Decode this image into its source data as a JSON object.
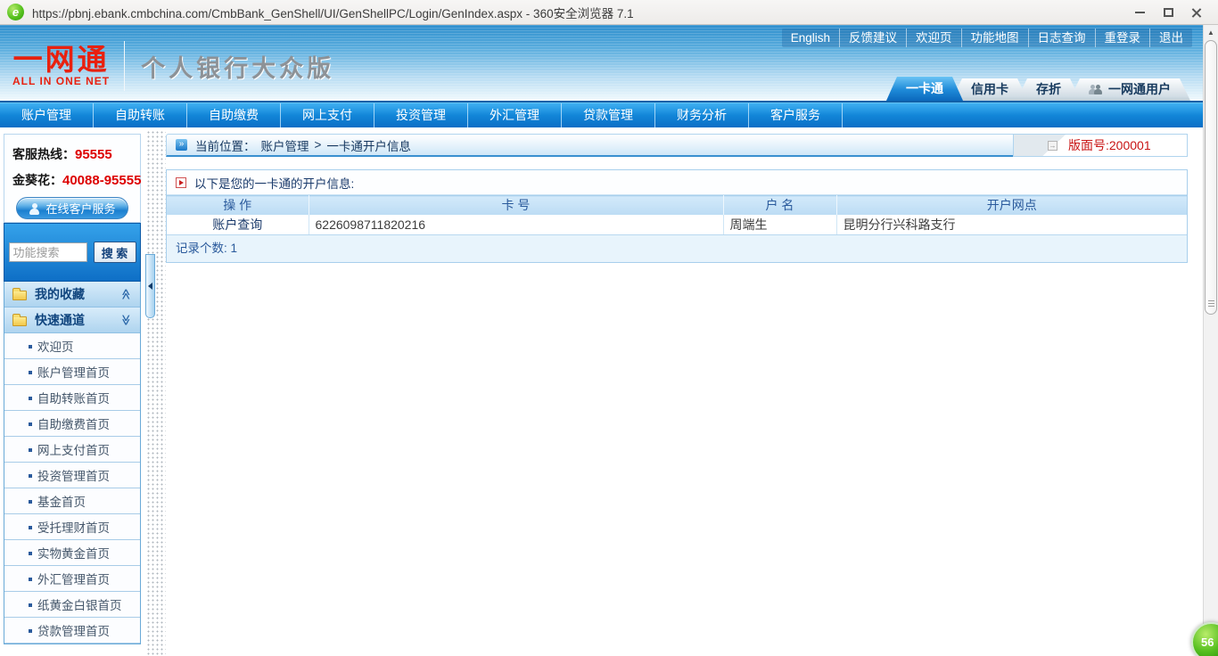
{
  "browser": {
    "title": "https://pbnj.ebank.cmbchina.com/CmbBank_GenShell/UI/GenShellPC/Login/GenIndex.aspx - 360安全浏览器 7.1",
    "speed_ball": "56"
  },
  "icons": {
    "collapse_up": "≪",
    "expand_down": "≫",
    "breadcrumb_arrow": "»",
    "scroll_up": "▲",
    "page_arrow": "→"
  },
  "header": {
    "top_links": [
      "English",
      "反馈建议",
      "欢迎页",
      "功能地图",
      "日志查询",
      "重登录",
      "退出"
    ],
    "logo": {
      "brand": "一网通",
      "brand_sub": "ALL IN ONE NET",
      "product": "个人银行大众版"
    },
    "tabs": [
      {
        "label": "一卡通",
        "active": true
      },
      {
        "label": "信用卡",
        "active": false
      },
      {
        "label": "存折",
        "active": false
      },
      {
        "label": "一网通用户",
        "active": false
      }
    ]
  },
  "nav": {
    "items": [
      "账户管理",
      "自助转账",
      "自助缴费",
      "网上支付",
      "投资管理",
      "外汇管理",
      "贷款管理",
      "财务分析",
      "客户服务"
    ]
  },
  "sidebar": {
    "hotline": {
      "label": "客服热线：",
      "number": "95555"
    },
    "vip": {
      "label": "金葵花：",
      "number": "40088-95555"
    },
    "service_button": "在线客户服务",
    "search": {
      "placeholder": "功能搜索",
      "button": "搜 索"
    },
    "sections": [
      {
        "label": "我的收藏"
      },
      {
        "label": "快速通道"
      }
    ],
    "quick_links": [
      "欢迎页",
      "账户管理首页",
      "自助转账首页",
      "自助缴费首页",
      "网上支付首页",
      "投资管理首页",
      "基金首页",
      "受托理财首页",
      "实物黄金首页",
      "外汇管理首页",
      "纸黄金白银首页",
      "贷款管理首页"
    ]
  },
  "main": {
    "breadcrumb": {
      "label": "当前位置：",
      "path": "账户管理",
      "sep": ">",
      "current": "一卡通开户信息",
      "page_no": "版面号:200001"
    },
    "panel": {
      "title": "以下是您的一卡通的开户信息:",
      "table": {
        "headers": [
          "操 作",
          "卡 号",
          "户 名",
          "开户网点"
        ],
        "rows": [
          [
            "账户查询",
            "6226098711820216",
            "周端生",
            "昆明分行兴科路支行"
          ]
        ]
      },
      "record_count": "记录个数: 1"
    }
  },
  "colors": {
    "accent_blue": "#1286d8",
    "brand_red": "#e8210f",
    "alert_red": "#dd0000"
  }
}
